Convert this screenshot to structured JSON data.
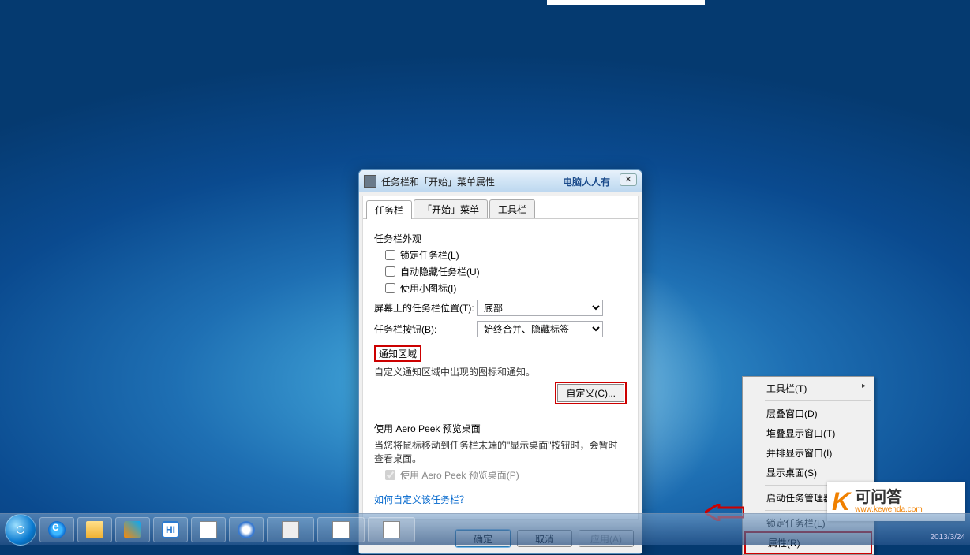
{
  "dialog": {
    "title": "任务栏和「开始」菜单属性",
    "title_right": "电脑人人有",
    "close_glyph": "✕",
    "tabs": {
      "taskbar": "任务栏",
      "start": "「开始」菜单",
      "toolbars": "工具栏"
    },
    "appearance_title": "任务栏外观",
    "lock": "锁定任务栏(L)",
    "autohide": "自动隐藏任务栏(U)",
    "smallicons": "使用小图标(I)",
    "position_label": "屏幕上的任务栏位置(T):",
    "position_value": "底部",
    "buttons_label": "任务栏按钮(B):",
    "buttons_value": "始终合并、隐藏标签",
    "notify_title": "通知区域",
    "notify_desc": "自定义通知区域中出现的图标和通知。",
    "customize_btn": "自定义(C)...",
    "peek_title": "使用 Aero Peek 预览桌面",
    "peek_desc": "当您将鼠标移动到任务栏末端的\"显示桌面\"按钮时，会暂时查看桌面。",
    "peek_chk": "使用 Aero Peek 预览桌面(P)",
    "help_link": "如何自定义该任务栏？",
    "ok": "确定",
    "cancel": "取消",
    "apply": "应用(A)"
  },
  "context_menu": {
    "toolbars": "工具栏(T)",
    "cascade": "层叠窗口(D)",
    "stack": "堆叠显示窗口(T)",
    "sidebyside": "并排显示窗口(I)",
    "showdesktop": "显示桌面(S)",
    "taskmgr": "启动任务管理器(K)",
    "lock": "锁定任务栏(L)",
    "properties": "属性(R)"
  },
  "watermark": {
    "k": "K",
    "l1": "可问答",
    "l2": "www.kewenda.com"
  },
  "taskbar": {
    "hi": "HI"
  },
  "footer_date": "2013/3/24"
}
